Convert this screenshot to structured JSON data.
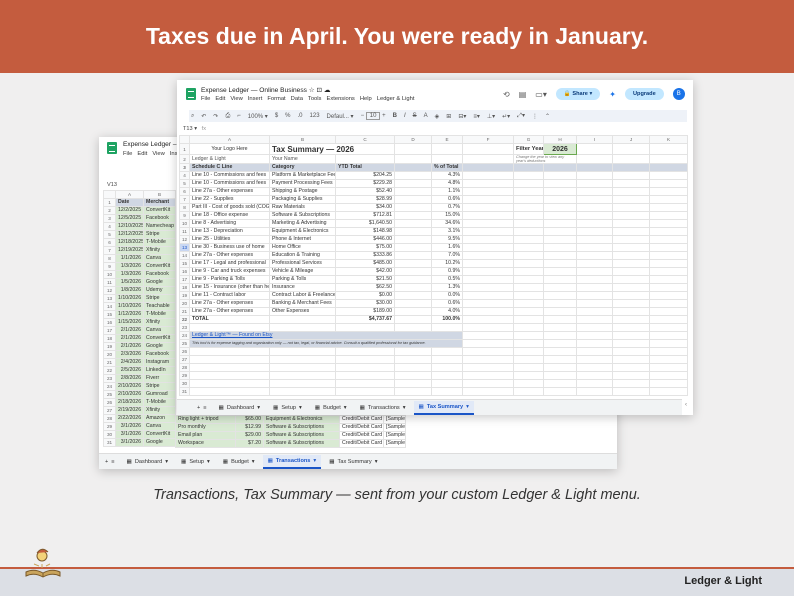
{
  "banner": {
    "headline": "Taxes due in April. You were ready in January."
  },
  "caption": "Transactions, Tax Summary — sent from your custom Ledger & Light menu.",
  "brand": "Ledger & Light",
  "back": {
    "title": "Expense Ledger – ",
    "menu": [
      "File",
      "Edit",
      "View",
      "Ins"
    ],
    "namebox": "V13",
    "col_letters": [
      "A",
      "B"
    ],
    "headers": [
      "Date",
      "Merchant"
    ],
    "rows": [
      [
        "12/2/2025",
        "ConvertKit"
      ],
      [
        "12/5/2025",
        "Facebook"
      ],
      [
        "12/10/2025",
        "Namecheap"
      ],
      [
        "12/12/2025",
        "Stripe"
      ],
      [
        "12/18/2025",
        "T-Mobile"
      ],
      [
        "12/19/2025",
        "Xfinity"
      ],
      [
        "1/1/2026",
        "Canva"
      ],
      [
        "1/3/2026",
        "ConvertKit"
      ],
      [
        "1/3/2026",
        "Facebook"
      ],
      [
        "1/5/2026",
        "Google"
      ],
      [
        "1/8/2026",
        "Udemy"
      ],
      [
        "1/10/2026",
        "Stripe"
      ],
      [
        "1/10/2026",
        "Teachable"
      ],
      [
        "1/12/2026",
        "T-Mobile"
      ],
      [
        "1/15/2026",
        "Xfinity"
      ],
      [
        "2/1/2026",
        "Canva"
      ],
      [
        "2/1/2026",
        "ConvertKit"
      ],
      [
        "2/1/2026",
        "Google"
      ],
      [
        "2/3/2026",
        "Facebook"
      ],
      [
        "2/4/2026",
        "Instagram"
      ],
      [
        "2/5/2026",
        "LinkedIn"
      ],
      [
        "2/8/2026",
        "Fiverr"
      ],
      [
        "2/10/2026",
        "Stripe"
      ],
      [
        "2/10/2026",
        "Gumroad"
      ],
      [
        "2/18/2026",
        "T-Mobile"
      ],
      [
        "2/19/2026",
        "Xfinity"
      ],
      [
        "2/22/2026",
        "Amazon"
      ],
      [
        "3/1/2026",
        "Canva"
      ],
      [
        "3/1/2026",
        "ConvertKit"
      ],
      [
        "3/1/2026",
        "Google"
      ]
    ],
    "extra_rows": [
      [
        "Ring light + tripod",
        "$65.00",
        "Equipment & Electronics",
        "Credit/Debit Card",
        "[Sample]"
      ],
      [
        "Pro monthly",
        "$12.99",
        "Software & Subscriptions",
        "Credit/Debit Card",
        "[Sample]"
      ],
      [
        "Email plan",
        "$29.00",
        "Software & Subscriptions",
        "Credit/Debit Card",
        "[Sample]"
      ],
      [
        "Workspace",
        "$7.20",
        "Software & Subscriptions",
        "Credit/Debit Card",
        "[Sample]"
      ]
    ],
    "tabs": [
      "Dashboard",
      "Setup",
      "Budget",
      "Transactions",
      "Tax Summary"
    ]
  },
  "front": {
    "title": "Expense Ledger — Online Business",
    "menu": [
      "File",
      "Edit",
      "View",
      "Insert",
      "Format",
      "Data",
      "Tools",
      "Extensions",
      "Help",
      "Ledger & Light"
    ],
    "share": "Share",
    "upgrade": "Upgrade",
    "avatar": "B",
    "zoom": "100%",
    "font": "Defaul...",
    "size": "10",
    "namebox": "T13",
    "col_letters": [
      "A",
      "B",
      "C",
      "D",
      "E",
      "F",
      "G",
      "H",
      "I",
      "J",
      "K"
    ],
    "logo_placeholder": "Your Logo Here",
    "sheet_title": "Tax Summary — 2026",
    "brand_line": "Ledger & Light",
    "name_line": "Your Name",
    "filter_label": "Filter Year:",
    "filter_year": "2026",
    "filter_hint": "Change the year to view any year's deductions",
    "headers": [
      "Schedule C Line",
      "Category",
      "YTD Total",
      "% of Total"
    ],
    "rows": [
      [
        "Line 10 - Commissions and fees",
        "Platform & Marketplace Fees",
        "$204.25",
        "4.3%"
      ],
      [
        "Line 10 - Commissions and fees",
        "Payment Processing Fees",
        "$229.28",
        "4.8%"
      ],
      [
        "Line 27a - Other expenses",
        "Shipping & Postage",
        "$52.40",
        "1.1%"
      ],
      [
        "Line 22 - Supplies",
        "Packaging & Supplies",
        "$28.99",
        "0.6%"
      ],
      [
        "Part III - Cost of goods sold (COGS)",
        "Raw Materials",
        "$34.00",
        "0.7%"
      ],
      [
        "Line 18 - Office expense",
        "Software & Subscriptions",
        "$712.81",
        "15.0%"
      ],
      [
        "Line 8 - Advertising",
        "Marketing & Advertising",
        "$1,640.50",
        "34.6%"
      ],
      [
        "Line 13 - Depreciation",
        "Equipment & Electronics",
        "$148.98",
        "3.1%"
      ],
      [
        "Line 25 - Utilities",
        "Phone & Internet",
        "$446.00",
        "9.5%"
      ],
      [
        "Line 30 - Business use of home",
        "Home Office",
        "$75.00",
        "1.6%"
      ],
      [
        "Line 27a - Other expenses",
        "Education & Training",
        "$333.86",
        "7.0%"
      ],
      [
        "Line 17 - Legal and professional",
        "Professional Services",
        "$485.00",
        "10.2%"
      ],
      [
        "Line 9 - Car and truck expenses",
        "Vehicle & Mileage",
        "$42.00",
        "0.9%"
      ],
      [
        "Line 9 - Parking & Tolls",
        "Parking & Tolls",
        "$21.50",
        "0.5%"
      ],
      [
        "Line 15 - Insurance (other than health)",
        "Insurance",
        "$62.50",
        "1.3%"
      ],
      [
        "Line 11 - Contract labor",
        "Contract Labor & Freelancers",
        "$0.00",
        "0.0%"
      ],
      [
        "Line 27a - Other expenses",
        "Banking & Merchant Fees",
        "$30.00",
        "0.6%"
      ],
      [
        "Line 27a - Other expenses",
        "Other Expenses",
        "$189.00",
        "4.0%"
      ]
    ],
    "total": [
      "TOTAL",
      "",
      "$4,737.67",
      "100.0%"
    ],
    "footer_link": "Ledger & Light™  —  Found on Etsy",
    "disclaimer": "This tool is for expense tagging and organization only — not tax, legal, or financial advice. Consult a qualified professional for tax guidance.",
    "tabs": [
      "Dashboard",
      "Setup",
      "Budget",
      "Transactions",
      "Tax Summary"
    ]
  },
  "colors": {
    "banner": "#c45c3e",
    "accent": "#1a55c7",
    "green": "#d9ead3"
  }
}
